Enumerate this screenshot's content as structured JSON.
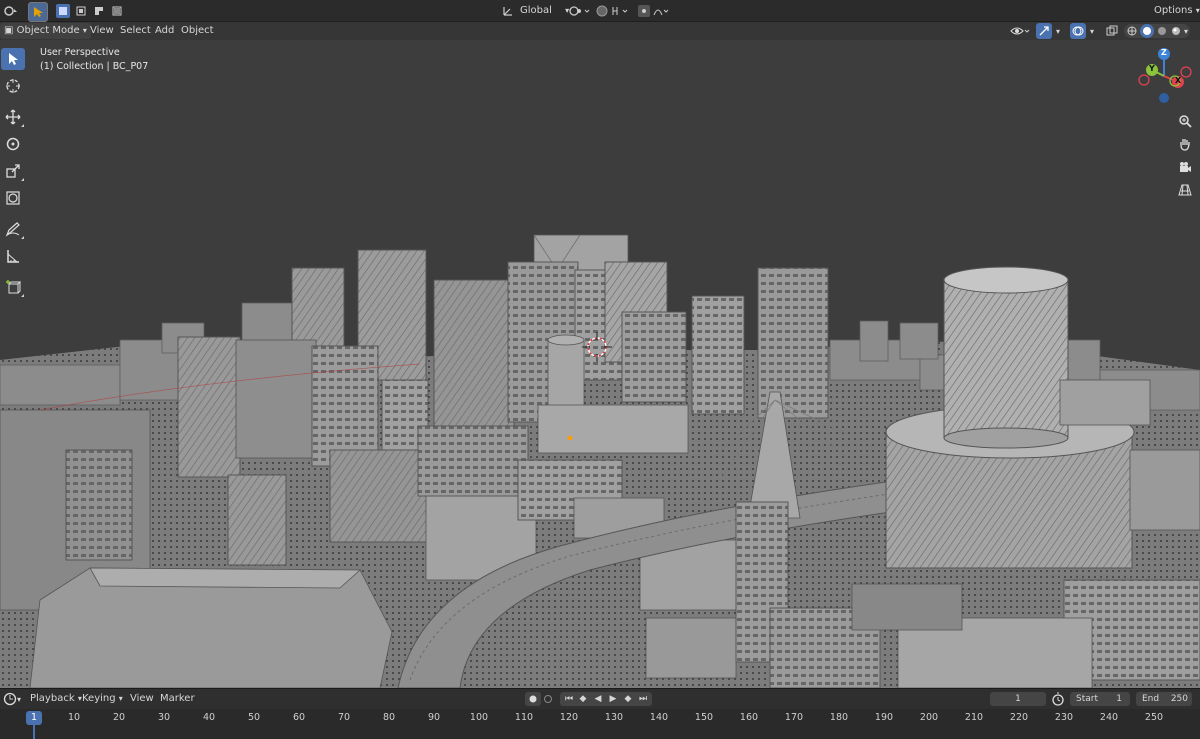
{
  "topbar": {
    "transform_orientation": "Global",
    "options_label": "Options"
  },
  "header": {
    "mode_label": "Object Mode",
    "menus": [
      "View",
      "Select",
      "Add",
      "Object"
    ]
  },
  "viewport": {
    "view_name": "User Perspective",
    "collection_info": "(1) Collection | BC_P07"
  },
  "gizmo": {
    "z": "Z",
    "y": "Y",
    "x": "X"
  },
  "timeline": {
    "menus": [
      "Playback",
      "Keying",
      "View",
      "Marker"
    ],
    "current_frame": "1",
    "start_label": "Start",
    "start_value": "1",
    "end_label": "End",
    "end_value": "250",
    "ruler": [
      "1",
      "10",
      "20",
      "30",
      "40",
      "50",
      "60",
      "70",
      "80",
      "90",
      "100",
      "110",
      "120",
      "130",
      "140",
      "150",
      "160",
      "170",
      "180",
      "190",
      "200",
      "210",
      "220",
      "230",
      "240",
      "250"
    ]
  },
  "colors": {
    "accent": "#4a72b0",
    "axis_x": "#e0414f",
    "axis_y": "#8ac43a",
    "axis_z": "#3d84d6"
  }
}
